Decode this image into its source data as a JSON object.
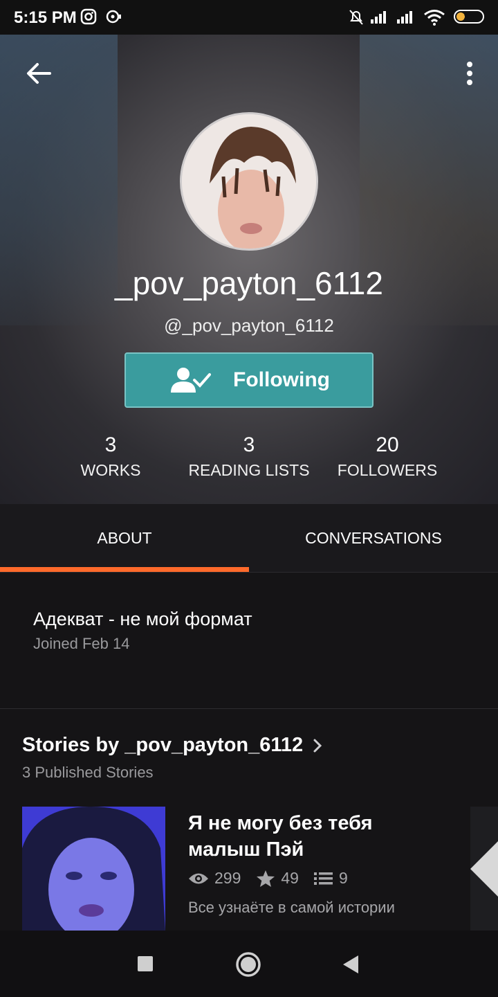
{
  "status_bar": {
    "time": "5:15 PM",
    "battery": "32",
    "battery_level": 0.32
  },
  "profile": {
    "display_name": "_pov_payton_6112",
    "username": "@_pov_payton_6112",
    "follow_button_label": "Following",
    "stats": [
      {
        "value": "3",
        "label": "WORKS"
      },
      {
        "value": "3",
        "label": "READING LISTS"
      },
      {
        "value": "20",
        "label": "FOLLOWERS"
      }
    ]
  },
  "tabs": [
    {
      "label": "ABOUT",
      "active": true
    },
    {
      "label": "CONVERSATIONS",
      "active": false
    }
  ],
  "about": {
    "tagline": "Адекват - не мой формат",
    "joined": "Joined Feb 14"
  },
  "stories": {
    "title": "Stories by _pov_payton_6112",
    "subtitle": "3 Published Stories",
    "items": [
      {
        "title": "Я не могу без тебя малыш Пэй",
        "views": "299",
        "votes": "49",
        "parts": "9",
        "description": "Все узнаёте в самой истории"
      }
    ]
  },
  "colors": {
    "accent": "#ff6a2b",
    "follow_button": "#3a9c9e"
  }
}
